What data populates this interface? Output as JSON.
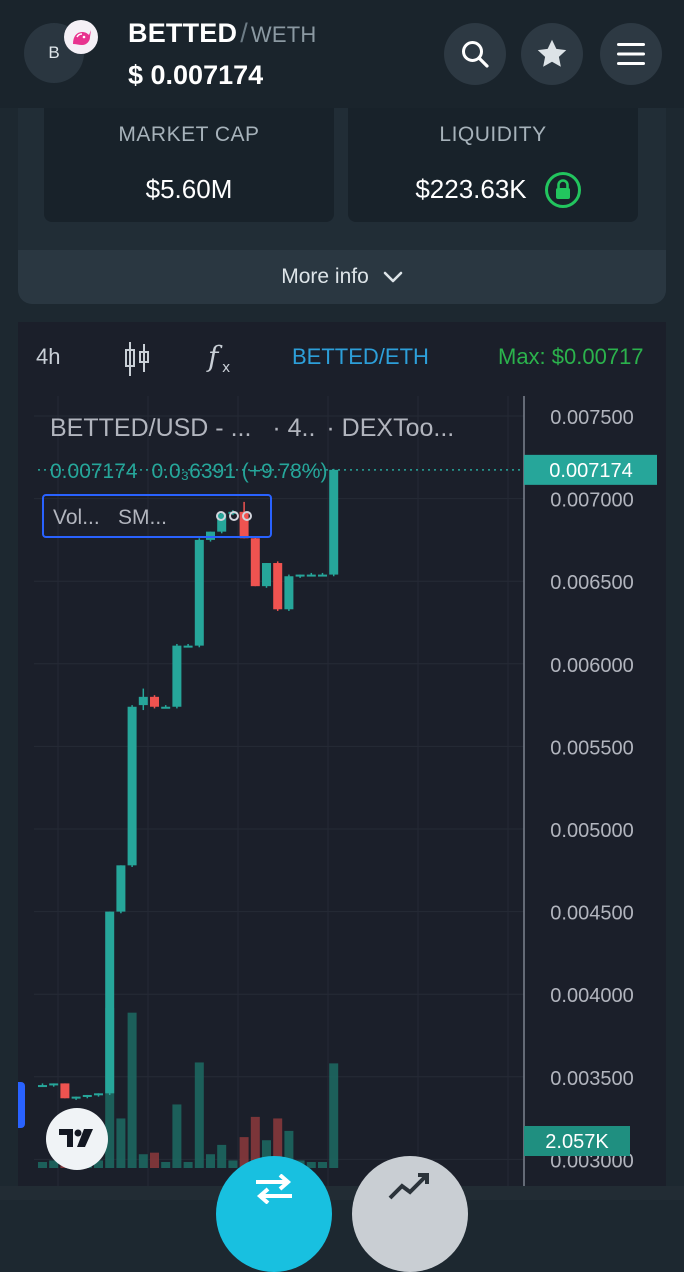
{
  "header": {
    "avatar_letter": "B",
    "base_symbol": "BETTED",
    "separator": "/",
    "quote_symbol": "WETH",
    "price": "$ 0.007174",
    "icons": [
      "search-icon",
      "star-icon",
      "menu-icon"
    ]
  },
  "stats": {
    "market_cap_label": "MARKET CAP",
    "market_cap_value": "$5.60M",
    "liquidity_label": "LIQUIDITY",
    "liquidity_value": "$223.63K",
    "liquidity_icon": "lock-icon"
  },
  "more_info": {
    "label": "More info"
  },
  "chart_toolbar": {
    "interval": "4h",
    "pair": "BETTED/ETH",
    "max_label": "Max: $0.00717"
  },
  "chart_legend": {
    "title": "BETTED/USD - ...",
    "interval": "· 4..",
    "source": "· DEXToo...",
    "last_price": "0.007174",
    "change": "0.0₃6391 (+9.78%)",
    "study_1": "Vol...",
    "study_2": "SM...",
    "price_tag": "0.007174",
    "volume_tag": "2.057K"
  },
  "chart_data": {
    "type": "candlestick",
    "title": "BETTED/USD",
    "y_ticks": [
      "0.007500",
      "0.007000",
      "0.006500",
      "0.006000",
      "0.005500",
      "0.005000",
      "0.004500",
      "0.004000",
      "0.003500",
      "0.003000"
    ],
    "ylim": [
      0.00295,
      0.0076
    ],
    "last_price": 0.007174,
    "colors": {
      "up": "#26a69a",
      "down": "#ef5350",
      "price_tag": "#26a69a"
    },
    "candles": [
      {
        "o": 0.00345,
        "h": 0.00346,
        "l": 0.00344,
        "c": 0.00345
      },
      {
        "o": 0.00345,
        "h": 0.00346,
        "l": 0.00344,
        "c": 0.00346
      },
      {
        "o": 0.00346,
        "h": 0.00346,
        "l": 0.00337,
        "c": 0.00337
      },
      {
        "o": 0.00337,
        "h": 0.00338,
        "l": 0.00336,
        "c": 0.00338
      },
      {
        "o": 0.00338,
        "h": 0.00339,
        "l": 0.00337,
        "c": 0.00339
      },
      {
        "o": 0.00339,
        "h": 0.0034,
        "l": 0.00338,
        "c": 0.0034
      },
      {
        "o": 0.0034,
        "h": 0.0045,
        "l": 0.00339,
        "c": 0.0045
      },
      {
        "o": 0.0045,
        "h": 0.00478,
        "l": 0.00449,
        "c": 0.00478
      },
      {
        "o": 0.00478,
        "h": 0.00575,
        "l": 0.00477,
        "c": 0.00574
      },
      {
        "o": 0.00575,
        "h": 0.00585,
        "l": 0.00572,
        "c": 0.0058
      },
      {
        "o": 0.0058,
        "h": 0.00581,
        "l": 0.00573,
        "c": 0.00574
      },
      {
        "o": 0.00574,
        "h": 0.00575,
        "l": 0.00573,
        "c": 0.00574
      },
      {
        "o": 0.00574,
        "h": 0.00612,
        "l": 0.00573,
        "c": 0.00611
      },
      {
        "o": 0.00611,
        "h": 0.00612,
        "l": 0.0061,
        "c": 0.00611
      },
      {
        "o": 0.00611,
        "h": 0.00676,
        "l": 0.0061,
        "c": 0.00675
      },
      {
        "o": 0.00675,
        "h": 0.0068,
        "l": 0.00674,
        "c": 0.0068
      },
      {
        "o": 0.0068,
        "h": 0.00692,
        "l": 0.00679,
        "c": 0.00691
      },
      {
        "o": 0.00691,
        "h": 0.00693,
        "l": 0.0069,
        "c": 0.00692
      },
      {
        "o": 0.00692,
        "h": 0.00698,
        "l": 0.00676,
        "c": 0.00676
      },
      {
        "o": 0.00676,
        "h": 0.00677,
        "l": 0.00647,
        "c": 0.00647
      },
      {
        "o": 0.00647,
        "h": 0.00661,
        "l": 0.00646,
        "c": 0.00661
      },
      {
        "o": 0.00661,
        "h": 0.00662,
        "l": 0.00632,
        "c": 0.00633
      },
      {
        "o": 0.00633,
        "h": 0.00654,
        "l": 0.00632,
        "c": 0.00653
      },
      {
        "o": 0.00653,
        "h": 0.00654,
        "l": 0.00652,
        "c": 0.00654
      },
      {
        "o": 0.00654,
        "h": 0.00655,
        "l": 0.00653,
        "c": 0.00654
      },
      {
        "o": 0.00654,
        "h": 0.00655,
        "l": 0.00653,
        "c": 0.00654
      },
      {
        "o": 0.00654,
        "h": 0.00718,
        "l": 0.00653,
        "c": 0.007174
      }
    ],
    "volume_label": "2.057K"
  }
}
